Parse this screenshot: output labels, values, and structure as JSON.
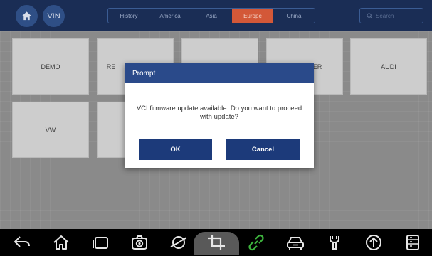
{
  "header": {
    "home_icon": "home-icon",
    "vin_label": "VIN",
    "tabs": [
      {
        "label": "History",
        "active": false
      },
      {
        "label": "America",
        "active": false
      },
      {
        "label": "Asia",
        "active": false
      },
      {
        "label": "Europe",
        "active": true
      },
      {
        "label": "China",
        "active": false
      }
    ],
    "search": {
      "placeholder": "Search",
      "icon": "search-icon"
    }
  },
  "grid": {
    "tiles": [
      {
        "label": "DEMO"
      },
      {
        "label": "RE"
      },
      {
        "label": ""
      },
      {
        "label": "ER"
      },
      {
        "label": "AUDI"
      },
      {
        "label": "VW"
      },
      {
        "label": ""
      }
    ]
  },
  "dialog": {
    "title": "Prompt",
    "message": "VCI firmware update available. Do you want to proceed with update?",
    "ok_label": "OK",
    "cancel_label": "Cancel"
  },
  "navbar": {
    "items": [
      "back-icon",
      "home-icon",
      "recent-apps-icon",
      "camera-icon",
      "browser-icon",
      "crop-icon",
      "vci-link-icon",
      "vehicle-icon",
      "tools-icon",
      "update-icon",
      "data-manager-icon"
    ],
    "active": "crop-icon",
    "link_color": "#3db33d"
  },
  "colors": {
    "accent_tab": "#d35838",
    "dialog_header": "#2a4a8a",
    "dialog_button": "#1c3a7a"
  }
}
